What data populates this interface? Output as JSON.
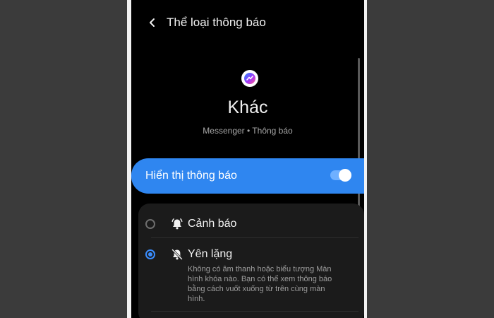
{
  "header": {
    "title": "Thể loại thông báo"
  },
  "app": {
    "icon": "messenger-icon",
    "name": "Khác",
    "subtitle": "Messenger • Thông báo"
  },
  "toggle": {
    "label": "Hiển thị thông báo",
    "enabled": true,
    "color": "#2f86f0"
  },
  "options": [
    {
      "icon": "bell-icon",
      "label": "Cảnh báo",
      "selected": false
    },
    {
      "icon": "bell-off-icon",
      "label": "Yên lặng",
      "selected": true,
      "description": "Không có âm thanh hoặc biểu tượng Màn hình khóa nào. Bạn có thể xem thông báo bằng cách vuốt xuống từ trên cùng màn hình."
    }
  ]
}
